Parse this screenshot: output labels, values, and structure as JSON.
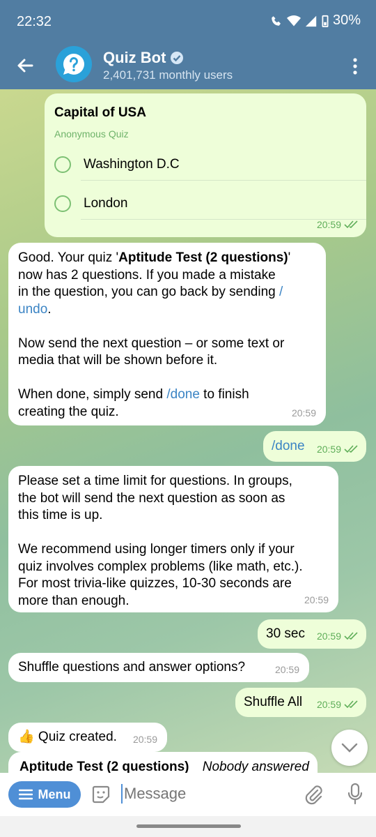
{
  "status": {
    "time": "22:32",
    "battery": "30%"
  },
  "header": {
    "title": "Quiz Bot",
    "subtitle": "2,401,731 monthly users"
  },
  "quiz_poll": {
    "title": "Capital of USA",
    "type": "Anonymous Quiz",
    "options": [
      "Washington D.C",
      "London"
    ],
    "time": "20:59"
  },
  "messages": {
    "m1": {
      "line1_pre": "Good. Your quiz '",
      "line1_bold": "Aptitude Test (2 questions)",
      "line1_post": "'",
      "line2": "now has 2 questions. If you made a mistake",
      "line3": "in the question, you can go back by sending ",
      "line3_link": "/",
      "line4_link": "undo",
      "line4_post": ".",
      "line5": "Now send the next question – or some text or",
      "line6": "media that will be shown before it.",
      "line7_pre": "When done, simply send ",
      "line7_link": "/done",
      "line7_post": " to finish",
      "line8": "creating the quiz.",
      "time": "20:59"
    },
    "m2": {
      "text": "/done",
      "time": "20:59"
    },
    "m3": {
      "line1": "Please set a time limit for questions. In groups,",
      "line2": "the bot will send the next question as soon as",
      "line3": "this time is up.",
      "line4": "We recommend using longer timers only if your",
      "line5": "quiz involves complex problems (like math, etc.).",
      "line6": "For most trivia-like quizzes, 10-30 seconds are",
      "line7": "more than enough.",
      "time": "20:59"
    },
    "m4": {
      "text": "30 sec",
      "time": "20:59"
    },
    "m5": {
      "text": "Shuffle questions and answer options?",
      "time": "20:59"
    },
    "m6": {
      "text": "Shuffle All",
      "time": "20:59"
    },
    "m7": {
      "text": "👍 Quiz created.",
      "time": "20:59"
    },
    "m8": {
      "title": "Aptitude Test (2 questions)",
      "note": "Nobody answered"
    }
  },
  "composer": {
    "menu_label": "Menu",
    "placeholder": "Message"
  },
  "colors": {
    "header": "#517da2",
    "outgoing": "#eefed9",
    "link": "#3b84c4",
    "accent": "#4f8fd6"
  }
}
